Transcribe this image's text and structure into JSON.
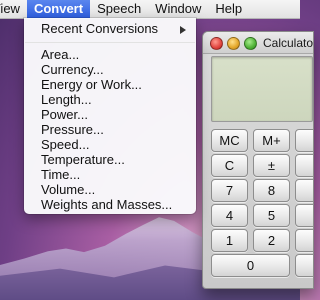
{
  "menubar": {
    "items": [
      {
        "label": "View"
      },
      {
        "label": "Convert"
      },
      {
        "label": "Speech"
      },
      {
        "label": "Window"
      },
      {
        "label": "Help"
      }
    ]
  },
  "convert_menu": {
    "submenu_label": "Recent Conversions",
    "items": [
      {
        "label": "Area..."
      },
      {
        "label": "Currency..."
      },
      {
        "label": "Energy or Work..."
      },
      {
        "label": "Length..."
      },
      {
        "label": "Power..."
      },
      {
        "label": "Pressure..."
      },
      {
        "label": "Speed..."
      },
      {
        "label": "Temperature..."
      },
      {
        "label": "Time..."
      },
      {
        "label": "Volume..."
      },
      {
        "label": "Weights and Masses..."
      }
    ]
  },
  "calculator": {
    "title": "Calculator",
    "keys": [
      {
        "label": "MC"
      },
      {
        "label": "M+"
      },
      {
        "label": "C"
      },
      {
        "label": "±"
      },
      {
        "label": "7"
      },
      {
        "label": "8"
      },
      {
        "label": "4"
      },
      {
        "label": "5"
      },
      {
        "label": "1"
      },
      {
        "label": "2"
      },
      {
        "label": "0"
      }
    ]
  },
  "colors": {
    "menu_highlight": "#2f5fe0"
  }
}
